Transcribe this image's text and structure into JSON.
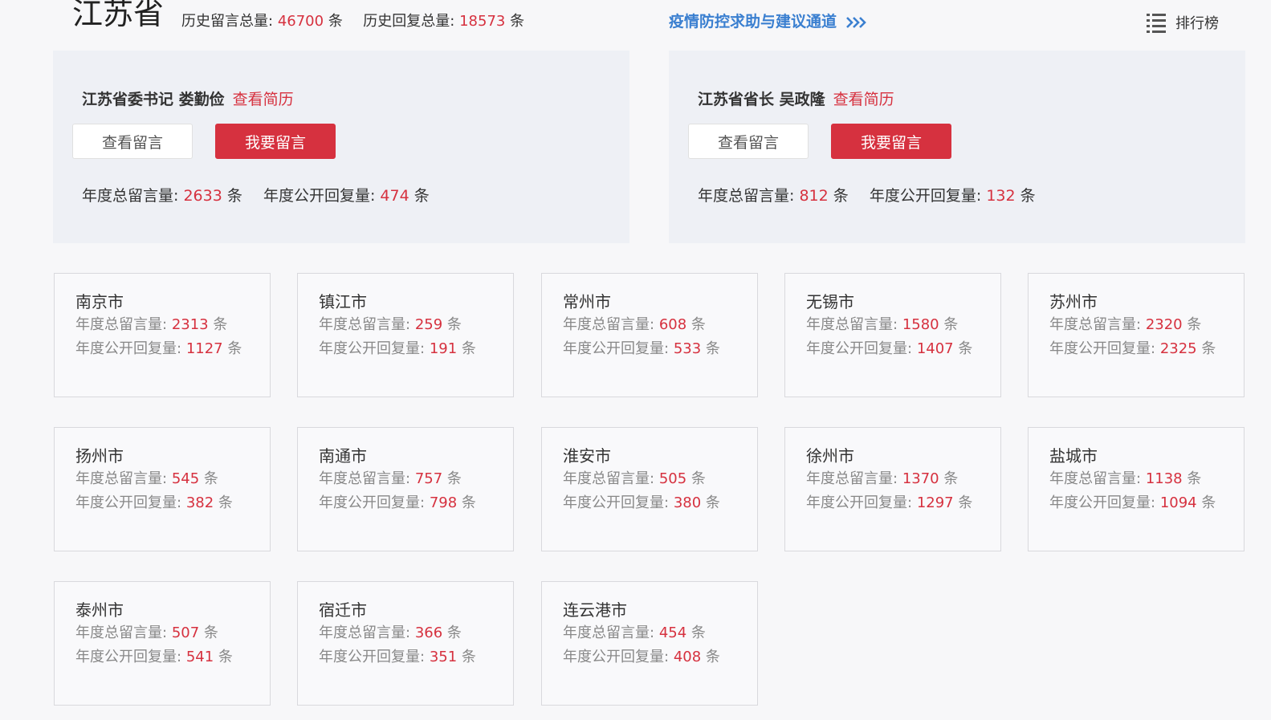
{
  "header": {
    "province": "江苏省",
    "history_total_label": "历史留言总量:",
    "history_total_value": "46700",
    "history_reply_label": "历史回复总量:",
    "history_reply_value": "18573",
    "unit": "条",
    "epidemic_link": "疫情防控求助与建议通道",
    "ranking_label": "排行榜"
  },
  "leaders": [
    {
      "title": "江苏省委书记 娄勤俭",
      "resume": "查看简历",
      "view_label": "查看留言",
      "post_label": "我要留言",
      "total_label": "年度总留言量:",
      "total_value": "2633",
      "reply_label": "年度公开回复量:",
      "reply_value": "474",
      "unit": "条"
    },
    {
      "title": "江苏省省长 吴政隆",
      "resume": "查看简历",
      "view_label": "查看留言",
      "post_label": "我要留言",
      "total_label": "年度总留言量:",
      "total_value": "812",
      "reply_label": "年度公开回复量:",
      "reply_value": "132",
      "unit": "条"
    }
  ],
  "city_labels": {
    "total": "年度总留言量:",
    "reply": "年度公开回复量:",
    "unit": "条"
  },
  "cities": [
    {
      "name": "南京市",
      "total": "2313",
      "reply": "1127"
    },
    {
      "name": "镇江市",
      "total": "259",
      "reply": "191"
    },
    {
      "name": "常州市",
      "total": "608",
      "reply": "533"
    },
    {
      "name": "无锡市",
      "total": "1580",
      "reply": "1407"
    },
    {
      "name": "苏州市",
      "total": "2320",
      "reply": "2325"
    },
    {
      "name": "扬州市",
      "total": "545",
      "reply": "382"
    },
    {
      "name": "南通市",
      "total": "757",
      "reply": "798"
    },
    {
      "name": "淮安市",
      "total": "505",
      "reply": "380"
    },
    {
      "name": "徐州市",
      "total": "1370",
      "reply": "1297"
    },
    {
      "name": "盐城市",
      "total": "1138",
      "reply": "1094"
    },
    {
      "name": "泰州市",
      "total": "507",
      "reply": "541"
    },
    {
      "name": "宿迁市",
      "total": "366",
      "reply": "351"
    },
    {
      "name": "连云港市",
      "total": "454",
      "reply": "408"
    }
  ],
  "colors": {
    "accent_red": "#d6313f",
    "link_blue": "#3a7fd0",
    "panel_bg": "#eef0f5"
  },
  "icons": {
    "epidemic_arrow": "double-chevron-right-icon",
    "ranking": "list-icon"
  }
}
